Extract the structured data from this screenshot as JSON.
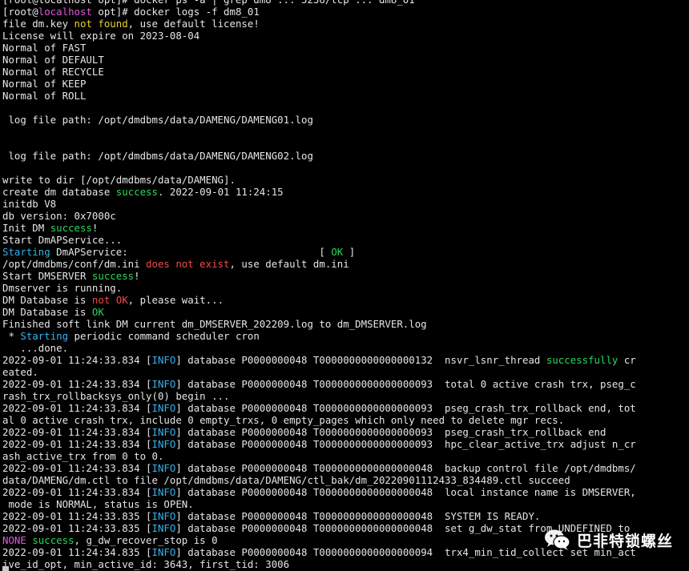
{
  "terminal": {
    "lines": [
      [
        {
          "t": "[root@localhost opt]# docker ps -a | grep dm8 ... 5236/tcp ... dm8_01",
          "c": "default"
        }
      ],
      [
        {
          "t": "[root@",
          "c": "default"
        },
        {
          "t": "localhost",
          "c": "pink"
        },
        {
          "t": " opt]# docker logs -f dm8_01",
          "c": "default"
        }
      ],
      [
        {
          "t": "file dm.key ",
          "c": "default"
        },
        {
          "t": "not found",
          "c": "yellow"
        },
        {
          "t": ", use default license!",
          "c": "default"
        }
      ],
      [
        {
          "t": "License will expire on 2023-08-04",
          "c": "default"
        }
      ],
      [
        {
          "t": "Normal of FAST",
          "c": "default"
        }
      ],
      [
        {
          "t": "Normal of DEFAULT",
          "c": "default"
        }
      ],
      [
        {
          "t": "Normal of RECYCLE",
          "c": "default"
        }
      ],
      [
        {
          "t": "Normal of KEEP",
          "c": "default"
        }
      ],
      [
        {
          "t": "Normal of ROLL",
          "c": "default"
        }
      ],
      [
        {
          "t": "",
          "c": "default"
        }
      ],
      [
        {
          "t": " log file path: /opt/dmdbms/data/DAMENG/DAMENG01.log",
          "c": "default"
        }
      ],
      [
        {
          "t": "",
          "c": "default"
        }
      ],
      [
        {
          "t": "",
          "c": "default"
        }
      ],
      [
        {
          "t": " log file path: /opt/dmdbms/data/DAMENG/DAMENG02.log",
          "c": "default"
        }
      ],
      [
        {
          "t": "",
          "c": "default"
        }
      ],
      [
        {
          "t": "write to dir [/opt/dmdbms/data/DAMENG].",
          "c": "default"
        }
      ],
      [
        {
          "t": "create dm database ",
          "c": "default"
        },
        {
          "t": "success",
          "c": "green"
        },
        {
          "t": ". 2022-09-01 11:24:15",
          "c": "default"
        }
      ],
      [
        {
          "t": "initdb V8",
          "c": "default"
        }
      ],
      [
        {
          "t": "db version: 0x7000c",
          "c": "default"
        }
      ],
      [
        {
          "t": "Init DM ",
          "c": "default"
        },
        {
          "t": "success",
          "c": "green"
        },
        {
          "t": "!",
          "c": "default"
        }
      ],
      [
        {
          "t": "Start DmAPService...",
          "c": "default"
        }
      ],
      [
        {
          "t": "Starting",
          "c": "cyan"
        },
        {
          "t": " DmAPService:                                [ ",
          "c": "default"
        },
        {
          "t": "OK",
          "c": "green"
        },
        {
          "t": " ]",
          "c": "default"
        }
      ],
      [
        {
          "t": "/opt/dmdbms/conf/dm.ini ",
          "c": "default"
        },
        {
          "t": "does not exist",
          "c": "red"
        },
        {
          "t": ", use default dm.ini",
          "c": "default"
        }
      ],
      [
        {
          "t": "Start DMSERVER ",
          "c": "default"
        },
        {
          "t": "success",
          "c": "green"
        },
        {
          "t": "!",
          "c": "default"
        }
      ],
      [
        {
          "t": "Dmserver is running.",
          "c": "default"
        }
      ],
      [
        {
          "t": "DM Database is ",
          "c": "default"
        },
        {
          "t": "not OK",
          "c": "red"
        },
        {
          "t": ", please wait...",
          "c": "default"
        }
      ],
      [
        {
          "t": "DM Database is ",
          "c": "default"
        },
        {
          "t": "OK",
          "c": "green"
        }
      ],
      [
        {
          "t": "Finished soft link DM current dm_DMSERVER_202209.log to dm_DMSERVER.log",
          "c": "default"
        }
      ],
      [
        {
          "t": " * ",
          "c": "default"
        },
        {
          "t": "Starting",
          "c": "cyan"
        },
        {
          "t": " periodic command scheduler cron",
          "c": "default"
        }
      ],
      [
        {
          "t": "   ...done.",
          "c": "default"
        }
      ],
      [
        {
          "t": "2022-09-01 11:24:33.834 [",
          "c": "default"
        },
        {
          "t": "INFO",
          "c": "cyan"
        },
        {
          "t": "] database P0000000048 T0000000000000000132  nsvr_lsnr_thread ",
          "c": "default"
        },
        {
          "t": "successfully",
          "c": "green"
        },
        {
          "t": " cr",
          "c": "default"
        }
      ],
      [
        {
          "t": "eated.",
          "c": "default"
        }
      ],
      [
        {
          "t": "2022-09-01 11:24:33.834 [",
          "c": "default"
        },
        {
          "t": "INFO",
          "c": "cyan"
        },
        {
          "t": "] database P0000000048 T0000000000000000093  total 0 active crash trx, pseg_c",
          "c": "default"
        }
      ],
      [
        {
          "t": "rash_trx_rollbacksys_only(0) begin ...",
          "c": "default"
        }
      ],
      [
        {
          "t": "2022-09-01 11:24:33.834 [",
          "c": "default"
        },
        {
          "t": "INFO",
          "c": "cyan"
        },
        {
          "t": "] database P0000000048 T0000000000000000093  pseg_crash_trx_rollback end, tot",
          "c": "default"
        }
      ],
      [
        {
          "t": "al 0 active crash trx, include 0 empty_trxs, 0 empty_pages which only need to delete mgr recs.",
          "c": "default"
        }
      ],
      [
        {
          "t": "2022-09-01 11:24:33.834 [",
          "c": "default"
        },
        {
          "t": "INFO",
          "c": "cyan"
        },
        {
          "t": "] database P0000000048 T0000000000000000093  pseg_crash_trx_rollback end",
          "c": "default"
        }
      ],
      [
        {
          "t": "2022-09-01 11:24:33.834 [",
          "c": "default"
        },
        {
          "t": "INFO",
          "c": "cyan"
        },
        {
          "t": "] database P0000000048 T0000000000000000093  hpc_clear_active_trx adjust n_cr",
          "c": "default"
        }
      ],
      [
        {
          "t": "ash_active_trx from 0 to 0.",
          "c": "default"
        }
      ],
      [
        {
          "t": "2022-09-01 11:24:33.834 [",
          "c": "default"
        },
        {
          "t": "INFO",
          "c": "cyan"
        },
        {
          "t": "] database P0000000048 T0000000000000000048  backup control file /opt/dmdbms/",
          "c": "default"
        }
      ],
      [
        {
          "t": "data/DAMENG/dm.ctl to file /opt/dmdbms/data/DAMENG/ctl_bak/dm_20220901112433_834489.ctl succeed",
          "c": "default"
        }
      ],
      [
        {
          "t": "2022-09-01 11:24:33.834 [",
          "c": "default"
        },
        {
          "t": "INFO",
          "c": "cyan"
        },
        {
          "t": "] database P0000000048 T0000000000000000048  local instance name is DMSERVER,",
          "c": "default"
        }
      ],
      [
        {
          "t": " mode is NORMAL, status is OPEN.",
          "c": "default"
        }
      ],
      [
        {
          "t": "2022-09-01 11:24:33.835 [",
          "c": "default"
        },
        {
          "t": "INFO",
          "c": "cyan"
        },
        {
          "t": "] database P0000000048 T0000000000000000048  SYSTEM IS READY.",
          "c": "default"
        }
      ],
      [
        {
          "t": "2022-09-01 11:24:33.835 [",
          "c": "default"
        },
        {
          "t": "INFO",
          "c": "cyan"
        },
        {
          "t": "] database P0000000048 T0000000000000000048  set g_dw_stat from UNDEFINED to",
          "c": "default"
        }
      ],
      [
        {
          "t": "NONE",
          "c": "pink"
        },
        {
          "t": " ",
          "c": "default"
        },
        {
          "t": "success",
          "c": "green"
        },
        {
          "t": ", g_dw_recover_stop is 0",
          "c": "default"
        }
      ],
      [
        {
          "t": "2022-09-01 11:24:34.835 [",
          "c": "default"
        },
        {
          "t": "INFO",
          "c": "cyan"
        },
        {
          "t": "] database P0000000048 T0000000000000000094  trx4_min_tid_collect set min_act",
          "c": "default"
        }
      ],
      [
        {
          "t": "ive_id_opt, min_active_id: 3643, first_tid: 3006",
          "c": "default"
        }
      ]
    ]
  },
  "watermark": {
    "icon": "wechat-icon",
    "text": "巴非特锁螺丝"
  },
  "colors": {
    "background": "#000000",
    "default": "#e6e6e6",
    "green": "#2dd65c",
    "red": "#ee4b4b",
    "yellow": "#e8d22f",
    "pink": "#e05be0",
    "cyan": "#35b3ee"
  }
}
